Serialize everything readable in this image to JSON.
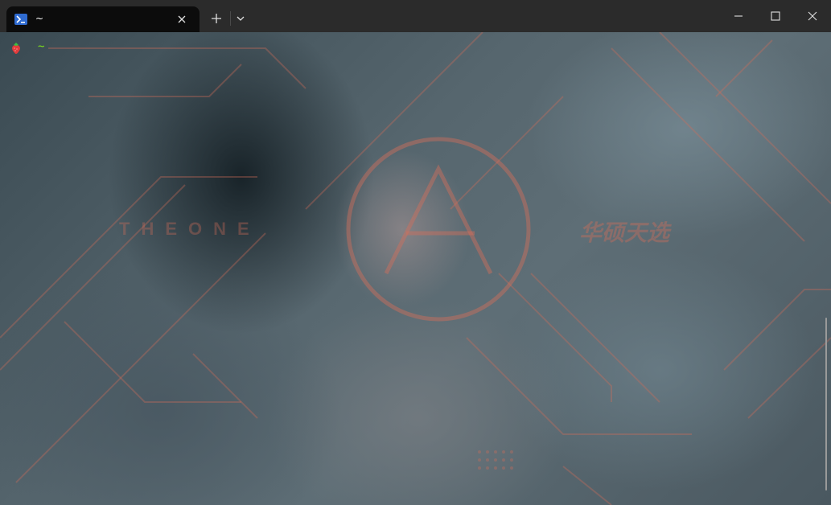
{
  "window": {
    "tab_title": "~",
    "tab_icon": "powershell-icon",
    "new_tab_icon": "plus-icon",
    "dropdown_icon": "chevron-down-icon",
    "controls": [
      "minimize-icon",
      "maximize-icon",
      "close-icon"
    ]
  },
  "terminal": {
    "prompt_icon": "strawberry-icon",
    "prompt_path": "~",
    "prompt_color": "#7ee11a",
    "background_watermark_latin": "THEONE",
    "background_watermark_cjk": "华硕天选",
    "accent_color": "#d2664f"
  }
}
